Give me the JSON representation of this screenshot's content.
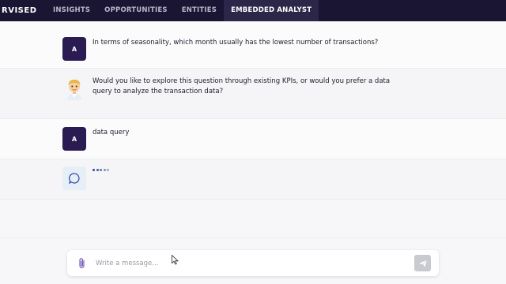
{
  "brand": {
    "text": "RVISED"
  },
  "nav": {
    "tabs": [
      {
        "label": "INSIGHTS"
      },
      {
        "label": "OPPORTUNITIES"
      },
      {
        "label": "ENTITIES"
      },
      {
        "label": "EMBEDDED ANALYST",
        "active": true
      }
    ]
  },
  "messages": [
    {
      "role": "user",
      "avatar": "A",
      "text": "In terms of seasonality, which month usually has the lowest number of transactions?"
    },
    {
      "role": "bot",
      "avatar_icon": "person-emoji-icon",
      "text": "Would you like to explore this question through existing KPIs, or would you prefer a data query to analyze the transaction data?"
    },
    {
      "role": "user",
      "avatar": "A",
      "text": "data query"
    },
    {
      "role": "bot",
      "avatar_icon": "chat-bubble-icon",
      "typing": true
    }
  ],
  "composer": {
    "placeholder": "Write a message...",
    "value": ""
  },
  "colors": {
    "topbar": "#1b1534",
    "active_tab": "#2c2749",
    "user_avatar": "#2a1b52",
    "attach_icon": "#6b4fb3"
  }
}
